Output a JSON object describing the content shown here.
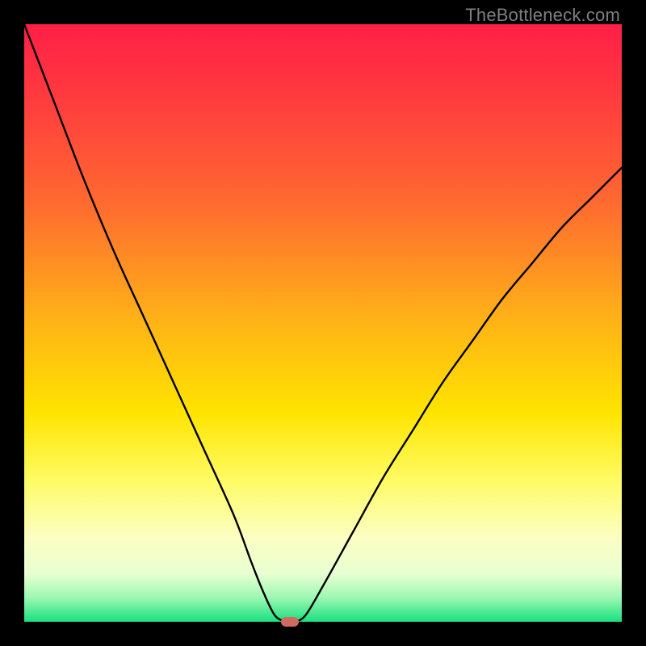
{
  "watermark": {
    "text": "TheBottleneck.com"
  },
  "colors": {
    "frame": "#000000",
    "curve": "#000000",
    "watermark": "#7f7f7f",
    "marker": "#cf6a60",
    "gradient_stops": [
      {
        "pct": 0,
        "color": "#ff1f46"
      },
      {
        "pct": 12,
        "color": "#ff3a3f"
      },
      {
        "pct": 30,
        "color": "#ff6a30"
      },
      {
        "pct": 50,
        "color": "#ffb416"
      },
      {
        "pct": 65,
        "color": "#ffe400"
      },
      {
        "pct": 76,
        "color": "#fffb61"
      },
      {
        "pct": 86,
        "color": "#fbffc3"
      },
      {
        "pct": 92,
        "color": "#e8ffd2"
      },
      {
        "pct": 96,
        "color": "#9cf7b2"
      },
      {
        "pct": 100,
        "color": "#18e07e"
      }
    ]
  },
  "chart_data": {
    "type": "line",
    "title": "",
    "xlabel": "",
    "ylabel": "",
    "xlim": [
      0,
      100
    ],
    "ylim": [
      0,
      100
    ],
    "x": [
      0,
      5,
      10,
      15,
      20,
      25,
      30,
      35,
      38,
      40,
      42,
      44,
      45,
      47,
      50,
      55,
      60,
      65,
      70,
      75,
      80,
      85,
      90,
      95,
      100
    ],
    "values": [
      100,
      87,
      74,
      62,
      51,
      40,
      29,
      18,
      10,
      5,
      1,
      0,
      0,
      1,
      6,
      15,
      24,
      32,
      40,
      47,
      54,
      60,
      66,
      71,
      76
    ],
    "flat_region_x": [
      43,
      46
    ],
    "marker": {
      "x": 44.5,
      "y": 0
    }
  }
}
